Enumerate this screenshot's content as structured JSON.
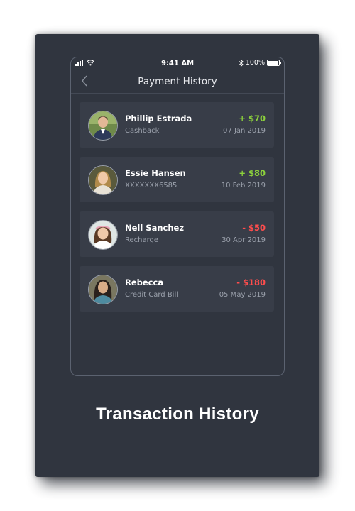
{
  "status_bar": {
    "time": "9:41 AM",
    "battery": "100%"
  },
  "nav": {
    "title": "Payment History"
  },
  "transactions": [
    {
      "name": "Phillip Estrada",
      "detail": "Cashback",
      "amount": "+ $70",
      "date": "07 Jan 2019",
      "type": "credit"
    },
    {
      "name": "Essie Hansen",
      "detail": "XXXXXXX6585",
      "amount": "+ $80",
      "date": "10 Feb 2019",
      "type": "credit"
    },
    {
      "name": "Nell Sanchez",
      "detail": "Recharge",
      "amount": "- $50",
      "date": "30 Apr 2019",
      "type": "debit"
    },
    {
      "name": "Rebecca",
      "detail": "Credit Card Bill",
      "amount": "- $180",
      "date": "05 May 2019",
      "type": "debit"
    }
  ],
  "caption": "Transaction History",
  "colors": {
    "background": "#30353f",
    "card": "#383d48",
    "credit": "#8cd13c",
    "debit": "#ff4d4d"
  }
}
